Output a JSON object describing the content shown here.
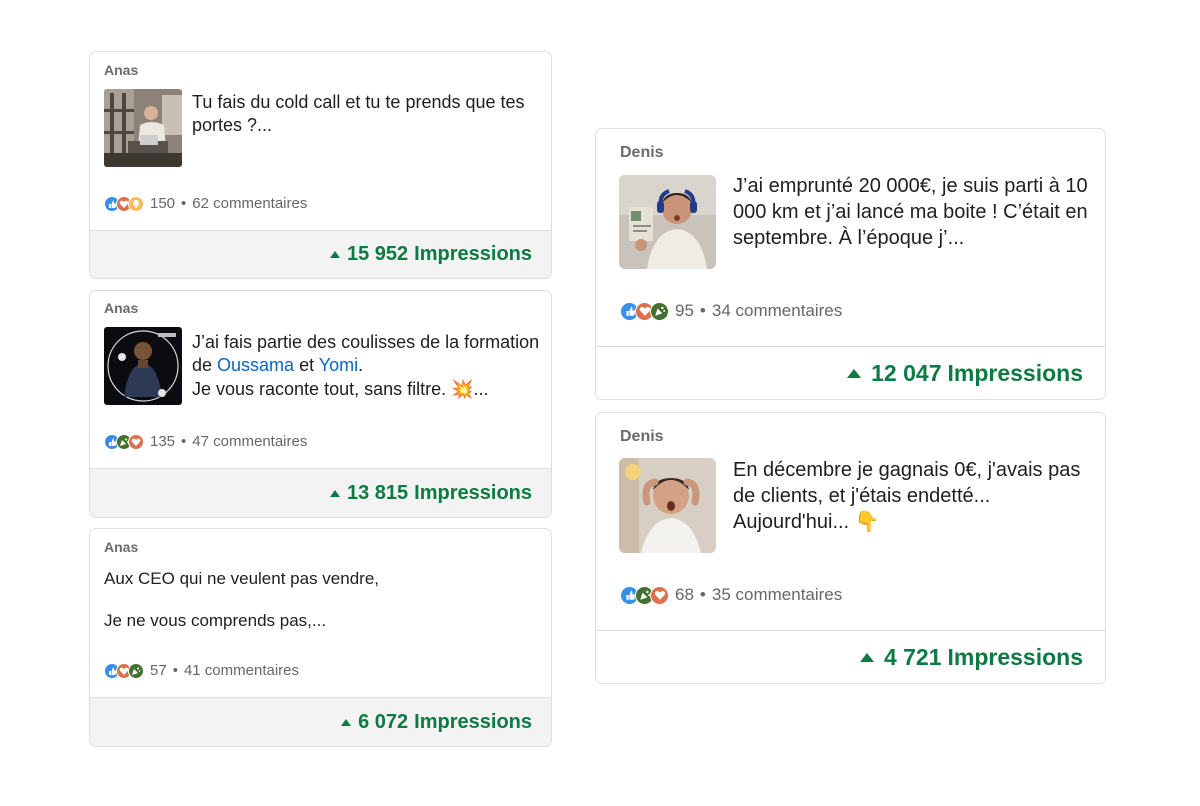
{
  "posts": [
    {
      "author": "Anas",
      "text_lines": [
        "Tu fais du cold call et tu te prends que tes portes ?..."
      ],
      "reaction_count": "150",
      "comments": "62 commentaires",
      "impressions_value": "15 952",
      "impressions_label": "Impressions",
      "reaction_icons": [
        "like-icon",
        "love-icon",
        "insightful-icon"
      ]
    },
    {
      "author": "Anas",
      "text_before_mentions": "J’ai fais partie des coulisses de la formation de ",
      "mention_1": "Oussama",
      "between_mentions": " et ",
      "mention_2": "Yomi",
      "after_mentions": ".",
      "text_line_3": "Je vous raconte tout, sans filtre. 💥...",
      "reaction_count": "135",
      "comments": "47 commentaires",
      "impressions_value": "13 815",
      "impressions_label": "Impressions",
      "reaction_icons": [
        "like-icon",
        "celebrate-icon",
        "love-icon"
      ]
    },
    {
      "author": "Anas",
      "text_line_1": "Aux CEO qui ne veulent pas vendre,",
      "text_line_2": "Je ne vous comprends pas,...",
      "reaction_count": "57",
      "comments": "41 commentaires",
      "impressions_value": "6 072",
      "impressions_label": "Impressions",
      "reaction_icons": [
        "like-icon",
        "love-icon",
        "celebrate-icon"
      ]
    },
    {
      "author": "Denis",
      "text": "J’ai emprunté 20 000€, je suis parti à 10 000 km et j’ai lancé ma boite ! C’était en septembre. À l’époque j’...",
      "reaction_count": "95",
      "comments": "34 commentaires",
      "impressions_value": "12 047",
      "impressions_label": "Impressions",
      "reaction_icons": [
        "like-icon",
        "love-icon",
        "celebrate-icon"
      ]
    },
    {
      "author": "Denis",
      "text": "En décembre je gagnais 0€, j'avais pas de clients, et j'étais endetté... Aujourd'hui... 👇",
      "reaction_count": "68",
      "comments": "35 commentaires",
      "impressions_value": "4 721",
      "impressions_label": "Impressions",
      "reaction_icons": [
        "like-icon",
        "celebrate-icon",
        "love-icon"
      ]
    }
  ],
  "separator": "•",
  "colors": {
    "impressions_green": "#0c7a43",
    "mention_blue": "#0a66c2",
    "like_blue": "#378fe9",
    "love_red": "#df704d",
    "celebrate_green": "#44712e",
    "insightful_yellow": "#f5bb5c",
    "footer_bg": "#f3f3f3",
    "author_gray": "#6b6b6b"
  }
}
